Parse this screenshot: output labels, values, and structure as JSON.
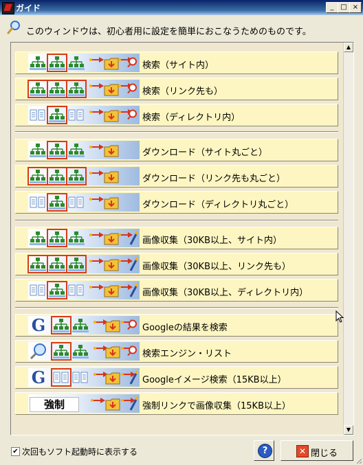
{
  "window": {
    "title": "ガイド",
    "minimize_glyph": "_",
    "maximize_glyph": "□",
    "close_glyph": "×"
  },
  "intro": {
    "icon": "magnifier-icon",
    "text": "このウィンドウは、初心者用に設定を簡単におこなうためのものです。"
  },
  "list": {
    "items": [
      {
        "label": "検索（サイト内）",
        "icon": "site-search"
      },
      {
        "label": "検索（リンク先も）",
        "icon": "link-search"
      },
      {
        "label": "検索（ディレクトリ内）",
        "icon": "directory-search"
      },
      {
        "label": "ダウンロード（サイト丸ごと）",
        "icon": "site-download"
      },
      {
        "label": "ダウンロード（リンク先も丸ごと）",
        "icon": "link-download"
      },
      {
        "label": "ダウンロード（ディレクトリ丸ごと）",
        "icon": "directory-download"
      },
      {
        "label": "画像収集（30KB以上、サイト内）",
        "icon": "site-image-collect"
      },
      {
        "label": "画像収集（30KB以上、リンク先も）",
        "icon": "link-image-collect"
      },
      {
        "label": "画像収集（30KB以上、ディレクトリ内）",
        "icon": "directory-image-collect"
      },
      {
        "label": "Googleの結果を検索",
        "icon": "google-search"
      },
      {
        "label": "検索エンジン・リスト",
        "icon": "search-engine-list"
      },
      {
        "label": "Googleイメージ検索（15KB以上）",
        "icon": "google-image-search"
      },
      {
        "label": "強制リンクで画像収集（15KB以上）",
        "icon": "forced-link-image-collect",
        "badge_text": "強制"
      }
    ],
    "scroll_up_glyph": "▲",
    "scroll_down_glyph": "▼"
  },
  "footer": {
    "checkbox_checked": true,
    "checkbox_glyph": "✔",
    "checkbox_label": "次回もソフト起動時に表示する",
    "help_glyph": "?",
    "close_glyph": "✕",
    "close_label": "閉じる"
  },
  "colors": {
    "title_bar": "#0a246a",
    "item_background": "#fdf6c2",
    "selection_outline": "#d83a16",
    "help_icon": "#2a5bc4",
    "close_icon": "#e04b2a"
  }
}
